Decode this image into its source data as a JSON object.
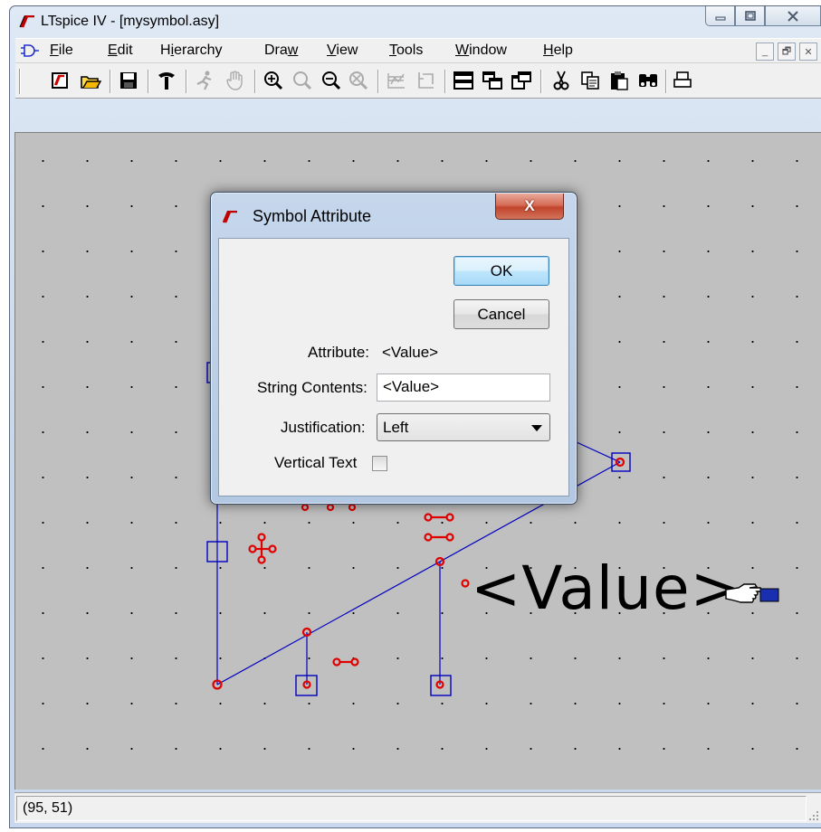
{
  "window": {
    "title": "LTspice IV - [mysymbol.asy]",
    "caption_buttons": {
      "minimize": "─",
      "maximize": "▢",
      "close": "✕"
    }
  },
  "menubar": {
    "items": [
      {
        "label": "File",
        "icon": "underline-first"
      },
      {
        "label": "Edit"
      },
      {
        "label": "Hierarchy"
      },
      {
        "label": "Draw"
      },
      {
        "label": "View"
      },
      {
        "label": "Tools"
      },
      {
        "label": "Window"
      },
      {
        "label": "Help"
      }
    ],
    "mdi_buttons": [
      "_",
      "🗗",
      "✕"
    ]
  },
  "toolbar": {
    "icons": [
      {
        "name": "new-schematic-icon",
        "glyph": "🗋"
      },
      {
        "name": "open-icon",
        "glyph": "📂"
      },
      {
        "name": "save-icon",
        "glyph": "🖫"
      },
      {
        "name": "control-panel-icon",
        "glyph": "⚒"
      },
      {
        "name": "run-icon",
        "glyph": "🏃"
      },
      {
        "name": "pan-icon",
        "glyph": "✋"
      },
      {
        "name": "zoom-in-icon",
        "glyph": "🔍"
      },
      {
        "name": "zoom-area-icon",
        "glyph": "🔍"
      },
      {
        "name": "zoom-out-icon",
        "glyph": "🔎"
      },
      {
        "name": "zoom-fit-icon",
        "glyph": "⊠"
      },
      {
        "name": "autorange-icon",
        "glyph": "⛶"
      },
      {
        "name": "place-icon",
        "glyph": "⛶"
      },
      {
        "name": "tile-horizontal-icon",
        "glyph": "☰"
      },
      {
        "name": "cascade-icon",
        "glyph": "❐"
      },
      {
        "name": "tile-vertical-icon",
        "glyph": "❐"
      },
      {
        "name": "cut-icon",
        "glyph": "✂"
      },
      {
        "name": "copy-icon",
        "glyph": "⎘"
      },
      {
        "name": "paste-icon",
        "glyph": "📋"
      },
      {
        "name": "find-icon",
        "glyph": "👁"
      },
      {
        "name": "print-icon",
        "glyph": "🖶"
      }
    ]
  },
  "dialog": {
    "title": "Symbol Attribute",
    "close_label": "X",
    "ok_label": "OK",
    "cancel_label": "Cancel",
    "attribute_label": "Attribute:",
    "attribute_value": "<Value>",
    "string_contents_label": "String Contents:",
    "string_contents_value": "<Value>",
    "justification_label": "Justification:",
    "justification_value": "Left",
    "vertical_text_label": "Vertical Text",
    "vertical_text_checked": false
  },
  "canvas": {
    "attribute_text": "<Value>",
    "background": "#c0c0c0",
    "line_color": "#0000c0",
    "pin_color": "#e00000"
  },
  "status": {
    "coordinates": "(95, 51)"
  }
}
